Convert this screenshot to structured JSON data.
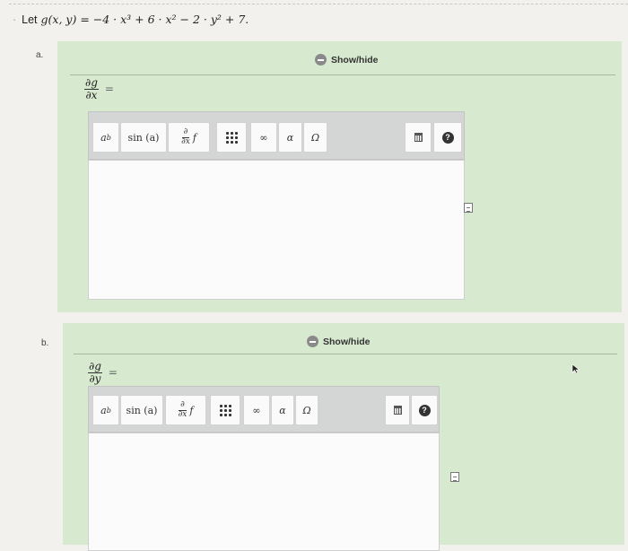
{
  "problem": {
    "lead": "Let",
    "expression": "g(x, y) = −4 · x³ + 6 · x² − 2 · y² + 7."
  },
  "parts": [
    {
      "letter": "a.",
      "show_hide": "Show/hide",
      "deriv_num": "∂g",
      "deriv_den": "∂x",
      "eq": "="
    },
    {
      "letter": "b.",
      "show_hide": "Show/hide",
      "deriv_num": "∂g",
      "deriv_den": "∂y",
      "eq": "="
    }
  ],
  "toolbar": {
    "power_base": "a",
    "power_exp": "b",
    "sin": "sin (a)",
    "deriv_num": "∂",
    "deriv_den": "∂x",
    "deriv_f": "f",
    "infinity": "∞",
    "alpha": "α",
    "omega": "Ω"
  },
  "icons": {
    "matrix": "matrix-icon",
    "trash": "trash-icon",
    "help": "help-icon",
    "show_hide": "collapse-icon",
    "doc": "document-icon",
    "cursor": "mouse-cursor-icon"
  }
}
